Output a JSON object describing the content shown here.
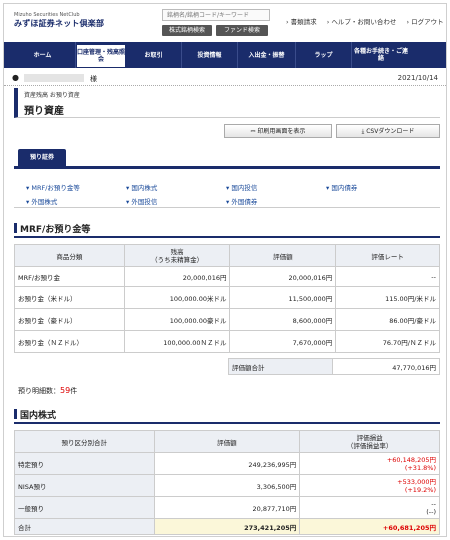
{
  "header": {
    "brand_sub": "Mizuho Securities NetClub",
    "brand": "みずほ証券ネット倶楽部",
    "search_placeholder": "銘柄名/銘柄コード/キーワード",
    "btn_stock": "株式銘柄検索",
    "btn_fund": "ファンド検索",
    "links": [
      "書類請求",
      "ヘルプ・お問い合わせ",
      "ログアウト"
    ]
  },
  "nav": [
    "ホーム",
    "口座管理・残高照会",
    "お取引",
    "投資情報",
    "入出金・振替",
    "ラップ",
    "各種お手続き・ご連絡"
  ],
  "user": {
    "suffix": "様",
    "date": "2021/10/14"
  },
  "page": {
    "crumb": "資産残高 お預り資産",
    "title": "預り資産",
    "print": "印刷用画面を表示",
    "csv": "CSVダウンロード",
    "tab": "預り証券"
  },
  "links": [
    "MRF/お預り金等",
    "国内株式",
    "国内投信",
    "国内債券",
    "外国株式",
    "外国投信",
    "外国債券"
  ],
  "mrf": {
    "title": "MRF/お預り金等",
    "headers": [
      "商品分類",
      "残高\n（うち未精算金）",
      "評価額",
      "評価レート"
    ],
    "rows": [
      [
        "MRF/お預り金",
        "20,000,016円",
        "20,000,016円",
        "--"
      ],
      [
        "お預り金（米ドル）",
        "100,000.00米ドル",
        "11,500,000円",
        "115.00円/米ドル"
      ],
      [
        "お預り金（豪ドル）",
        "100,000.00豪ドル",
        "8,600,000円",
        "86.00円/豪ドル"
      ],
      [
        "お預り金（ＮＺドル）",
        "100,000.00ＮＺドル",
        "7,670,000円",
        "76.70円/ＮＺドル"
      ]
    ],
    "total_label": "評価額合計",
    "total": "47,770,016円"
  },
  "count": {
    "label": "預り明細数：",
    "value": "59",
    "unit": "件"
  },
  "stocks": {
    "title": "国内株式",
    "headers": [
      "預り区分別合計",
      "評価額",
      "評価損益\n（評価損益率）"
    ],
    "rows": [
      [
        "特定預り",
        "249,236,995円",
        "+60,148,205円",
        "(+31.8%)"
      ],
      [
        "NISA預り",
        "3,306,500円",
        "+533,000円",
        "(+19.2%)"
      ],
      [
        "一般預り",
        "20,877,710円",
        "--",
        "(--)"
      ]
    ],
    "total": [
      "合計",
      "273,421,205円",
      "+60,681,205円"
    ]
  }
}
